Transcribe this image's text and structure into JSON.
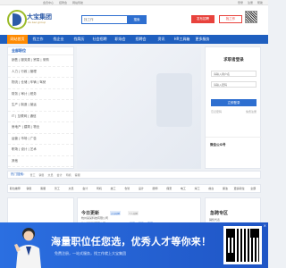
{
  "topbar": {
    "items": [
      "会员中心",
      "招聘会",
      "网站导航"
    ],
    "right": [
      "登录",
      "注册",
      "帮助"
    ]
  },
  "header": {
    "logo_name": "大宝集团",
    "logo_sub": "da bao group",
    "search_placeholder": "找工作",
    "search_button": "搜索",
    "post_button": "发布招聘",
    "resume_button": "找工作"
  },
  "nav": {
    "items": [
      "网站首页",
      "找工作",
      "找企业",
      "找简历",
      "社会招聘",
      "职场会",
      "招聘会",
      "资讯",
      "HR工具箱",
      "更多服务"
    ]
  },
  "sidebar": {
    "title": "全部职位",
    "rows": [
      "销售 | 服务类 | 贸易 | 采购",
      "人力 | 行政 | 管理",
      "物流 | 仓储 | 车辆 | 驾驶",
      "财务 | 审计 | 税务",
      "生产 | 制造 | 营运",
      "IT | 互联网 | 通信",
      "房地产 | 建筑 | 物业",
      "运营 | 市场 | 广告",
      "职场 | 设计 | 艺术",
      "其他"
    ]
  },
  "login": {
    "title": "求职者登录",
    "username_placeholder": "请输入用户名",
    "password_placeholder": "请输入密码",
    "submit": "立即登录",
    "forgot": "忘记密码",
    "register": "免费注册",
    "wechat_title": "微信公众号"
  },
  "hot": {
    "label": "热门搜索：",
    "items": [
      "普工",
      "销售",
      "文员",
      "会计",
      "司机",
      "客服"
    ]
  },
  "categories": [
    "职位推荐",
    "销售",
    "客服",
    "普工",
    "文员",
    "会计",
    "司机",
    "技工",
    "仓管",
    "设计",
    "厨师",
    "保安",
    "电工",
    "焊工",
    "前台",
    "保洁",
    "更多职位",
    "全部"
  ],
  "cards": {
    "left_title": "",
    "mid_title": "今日更新",
    "mid_tag_1": "企业招聘",
    "mid_tag_2": "个人招聘",
    "mid_rows": [
      {
        "company": "杭州某某某有限公司",
        "jobs": [
          "普工",
          "销售",
          "客服"
        ]
      },
      {
        "company": "杭州某某科技有限公司",
        "jobs": [
          "文员",
          "会计",
          "司机"
        ]
      }
    ],
    "right_title": "急聘专区",
    "right_rows": [
      "销售代表",
      "普工",
      "文员"
    ]
  },
  "promo": {
    "headline": "海量职位任您选，优秀人才等你来！",
    "sub": "免费注册，一站式服务，找工作就上大宝集团"
  }
}
